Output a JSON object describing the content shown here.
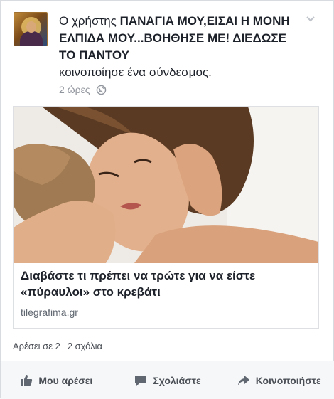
{
  "post": {
    "text_prefix": "Ο χρήστης ",
    "author": "ΠΑΝΑΓΙΑ ΜΟΥ,ΕΙΣΑΙ Η ΜΟΝΗ ΕΛΠΙΔΑ ΜΟΥ...ΒΟΗΘΗΣΕ ΜΕ!  ΔΙΕΔΩΣΕ ΤΟ ΠΑΝΤΟΥ",
    "action_text": "κοινοποίησε ένα σύνδεσμος.",
    "timestamp": "2 ώρες",
    "privacy_icon": "globe-icon",
    "menu_icon": "chevron-down-icon"
  },
  "link": {
    "title": "Διαβάστε τι πρέπει να τρώτε για να είστε «πύραυλοι» στο κρεβάτι",
    "domain": "tilegrafima.gr"
  },
  "reactions": {
    "likes": "Αρέσει σε 2",
    "comments": "2 σχόλια"
  },
  "actions": {
    "like": "Μου αρέσει",
    "comment": "Σχολιάστε",
    "share": "Κοινοποιήστε"
  },
  "colors": {
    "text": "#1d2129",
    "secondary": "#90949c",
    "action": "#4b4f56"
  }
}
